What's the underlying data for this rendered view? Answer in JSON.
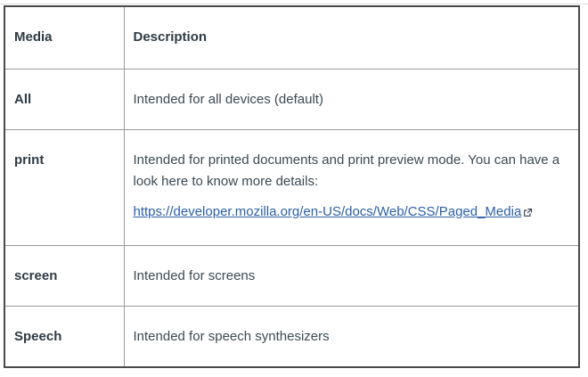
{
  "table": {
    "headers": {
      "media": "Media",
      "description": "Description"
    },
    "rows": [
      {
        "media": "All",
        "description": "Intended for all devices (default)"
      },
      {
        "media": "print",
        "description": "Intended for printed documents and print preview mode. You can have a look here to know more details:",
        "link": "https://developer.mozilla.org/en-US/docs/Web/CSS/Paged_Media",
        "link_icon": "external-link-icon"
      },
      {
        "media": "screen",
        "description": "Intended for screens"
      },
      {
        "media": "Speech",
        "description": "Intended for speech synthesizers"
      }
    ]
  },
  "colors": {
    "text": "#2d3b45",
    "link": "#2b5fa8",
    "border": "#4a4a4a"
  }
}
